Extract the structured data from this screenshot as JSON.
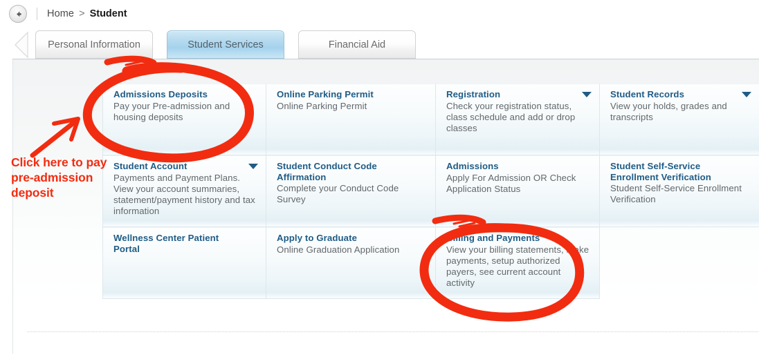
{
  "breadcrumb": {
    "back_icon": "back-arrow-circle-icon",
    "home_label": "Home",
    "separator": ">",
    "current_label": "Student"
  },
  "tabs": [
    {
      "id": "personal-information",
      "label": "Personal Information",
      "active": false
    },
    {
      "id": "student-services",
      "label": "Student Services",
      "active": true
    },
    {
      "id": "financial-aid",
      "label": "Financial Aid",
      "active": false
    }
  ],
  "grid": {
    "cells": [
      {
        "title": "Admissions Deposits",
        "desc": "Pay your Pre-admission and housing deposits",
        "caret": false
      },
      {
        "title": "Online Parking Permit",
        "desc": "Online Parking Permit",
        "caret": false
      },
      {
        "title": "Registration",
        "desc": "Check your registration status, class schedule and add or drop classes",
        "caret": true
      },
      {
        "title": "Student Records",
        "desc": "View your holds, grades and transcripts",
        "caret": true
      },
      {
        "title": "Student Account",
        "desc": "Payments and Payment Plans. View your account summaries, statement/payment history and tax information",
        "caret": true
      },
      {
        "title": "Student Conduct Code Affirmation",
        "desc": "Complete your Conduct Code Survey",
        "caret": false
      },
      {
        "title": "Admissions",
        "desc": "Apply For Admission OR Check Application Status",
        "caret": false
      },
      {
        "title": "Student Self-Service Enrollment Verification",
        "desc": "Student Self-Service Enrollment Verification",
        "caret": false
      },
      {
        "title": "Wellness Center Patient Portal",
        "desc": "",
        "caret": false
      },
      {
        "title": "Apply to Graduate",
        "desc": "Online Graduation Application",
        "caret": false
      },
      {
        "title": "Billing and Payments",
        "desc": "View your billing statements, make payments, setup authorized payers, see current account activity",
        "caret": false
      },
      {
        "title": "",
        "desc": "",
        "caret": false,
        "empty": true
      }
    ]
  },
  "annotation": {
    "text": "Click here to pay pre-admission deposit",
    "color": "#f22c10",
    "arrow_icon": "up-right-arrow-annotation",
    "circles": [
      {
        "name": "admissions-deposits-circle"
      },
      {
        "name": "billing-and-payments-circle"
      }
    ]
  },
  "colors": {
    "title_blue": "#1f5c85",
    "desc_gray": "#62676a",
    "annotation_red": "#f22c10",
    "active_tab_blue": "#a5d2ec"
  }
}
